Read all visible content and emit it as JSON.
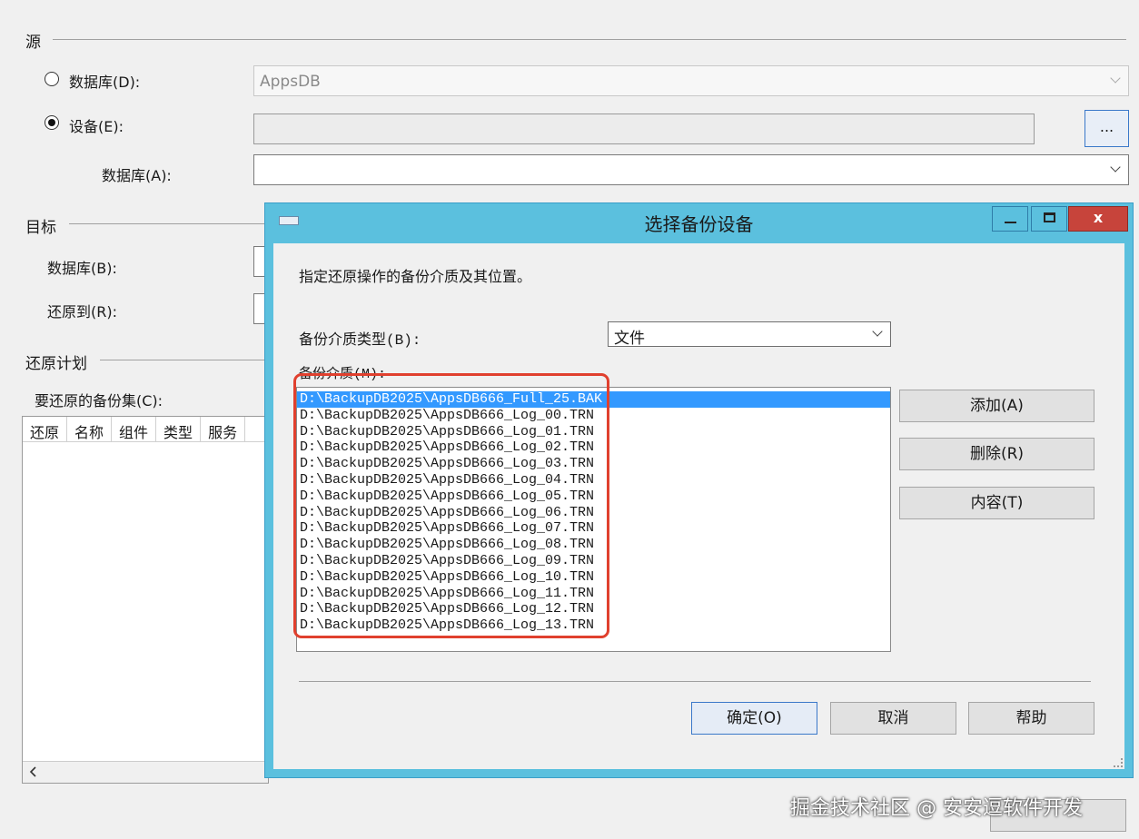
{
  "source": {
    "title": "源",
    "database_radio_label": "数据库(D):",
    "database_value": "AppsDB",
    "device_radio_label": "设备(E):",
    "device_value": "",
    "browse_label": "...",
    "device_database_label": "数据库(A):",
    "device_database_value": ""
  },
  "target": {
    "title": "目标",
    "database_label": "数据库(B):",
    "restore_to_label": "还原到(R):"
  },
  "plan": {
    "title": "还原计划",
    "backup_sets_label": "要还原的备份集(C):",
    "columns": [
      "还原",
      "名称",
      "组件",
      "类型",
      "服务"
    ]
  },
  "dialog": {
    "title": "选择备份设备",
    "instruction": "指定还原操作的备份介质及其位置。",
    "media_type_label": "备份介质类型(B):",
    "media_type_value": "文件",
    "media_label": "备份介质(M):",
    "media_items": [
      "D:\\BackupDB2025\\AppsDB666_Full_25.BAK",
      "D:\\BackupDB2025\\AppsDB666_Log_00.TRN",
      "D:\\BackupDB2025\\AppsDB666_Log_01.TRN",
      "D:\\BackupDB2025\\AppsDB666_Log_02.TRN",
      "D:\\BackupDB2025\\AppsDB666_Log_03.TRN",
      "D:\\BackupDB2025\\AppsDB666_Log_04.TRN",
      "D:\\BackupDB2025\\AppsDB666_Log_05.TRN",
      "D:\\BackupDB2025\\AppsDB666_Log_06.TRN",
      "D:\\BackupDB2025\\AppsDB666_Log_07.TRN",
      "D:\\BackupDB2025\\AppsDB666_Log_08.TRN",
      "D:\\BackupDB2025\\AppsDB666_Log_09.TRN",
      "D:\\BackupDB2025\\AppsDB666_Log_10.TRN",
      "D:\\BackupDB2025\\AppsDB666_Log_11.TRN",
      "D:\\BackupDB2025\\AppsDB666_Log_12.TRN",
      "D:\\BackupDB2025\\AppsDB666_Log_13.TRN"
    ],
    "add_label": "添加(A)",
    "remove_label": "删除(R)",
    "contents_label": "内容(T)",
    "ok_label": "确定(O)",
    "cancel_label": "取消",
    "help_label": "帮助",
    "close_label": "x"
  },
  "watermark": "掘金技术社区 @ 安安逗软件开发",
  "colors": {
    "dialog_frame": "#5bc0de",
    "close_button": "#c7443b",
    "selection": "#3399ff",
    "highlight": "#e0402e"
  }
}
